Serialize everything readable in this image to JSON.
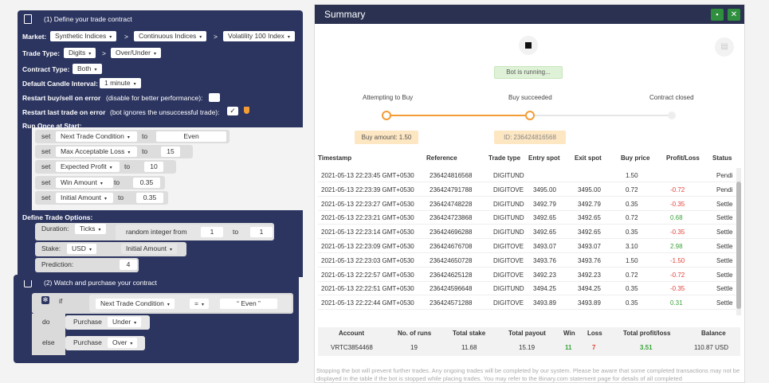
{
  "blocks": {
    "define_title": "(1) Define your trade contract",
    "market_label": "Market:",
    "market": "Synthetic Indices",
    "submarket": "Continuous Indices",
    "symbol": "Volatility 100 Index",
    "trade_type_label": "Trade Type:",
    "trade_type": "Digits",
    "trade_subtype": "Over/Under",
    "contract_type_label": "Contract Type:",
    "contract_type": "Both",
    "candle_label": "Default Candle Interval:",
    "candle": "1 minute",
    "restart_label": "Restart buy/sell on error",
    "restart_note": "(disable for better performance):",
    "restart_last_label": "Restart last trade on error",
    "restart_last_note": "(bot ignores the unsuccessful trade):",
    "run_once_label": "Run Once at Start:",
    "set": "set",
    "to": "to",
    "sets": [
      {
        "var": "Next Trade Condition",
        "value": "Even"
      },
      {
        "var": "Max Acceptable Loss",
        "value": "15"
      },
      {
        "var": "Expected Profit",
        "value": "10"
      },
      {
        "var": "Win Amount",
        "value": "0.35"
      },
      {
        "var": "Initial Amount",
        "value": "0.35"
      }
    ],
    "define_options_label": "Define Trade Options:",
    "duration_label": "Duration:",
    "duration_unit": "Ticks",
    "random_label": "random integer from",
    "random_from": "1",
    "random_to_label": "to",
    "random_to": "1",
    "stake_label": "Stake:",
    "currency": "USD",
    "stake_var": "Initial Amount",
    "prediction_label": "Prediction:",
    "prediction": "4",
    "watch_title": "(2) Watch and purchase your contract",
    "if_label": "if",
    "cond_var": "Next Trade Condition",
    "cond_op": "=",
    "cond_value": "Even",
    "do_label": "do",
    "else_label": "else",
    "purchase_label": "Purchase",
    "do_purchase": "Under",
    "else_purchase": "Over"
  },
  "summary": {
    "title": "Summary",
    "bot_status": "Bot is running...",
    "steps": [
      "Attempting to Buy",
      "Buy succeeded",
      "Contract closed"
    ],
    "buy_amount": "Buy amount: 1.50",
    "contract_id": "ID: 236424816568",
    "columns": [
      "Timestamp",
      "Reference",
      "Trade type",
      "Entry spot",
      "Exit spot",
      "Buy price",
      "Profit/Loss",
      "Status"
    ],
    "rows": [
      {
        "ts": "2021-05-13 22:23:45 GMT+0530",
        "ref": "236424816568",
        "type": "DIGITUND",
        "entry": "",
        "exit": "",
        "buy": "1.50",
        "pl": "",
        "plc": "",
        "status": "Pendi"
      },
      {
        "ts": "2021-05-13 22:23:39 GMT+0530",
        "ref": "236424791788",
        "type": "DIGITOVE",
        "entry": "3495.00",
        "exit": "3495.00",
        "buy": "0.72",
        "pl": "-0.72",
        "plc": "neg",
        "status": "Pendi"
      },
      {
        "ts": "2021-05-13 22:23:27 GMT+0530",
        "ref": "236424748228",
        "type": "DIGITUND",
        "entry": "3492.79",
        "exit": "3492.79",
        "buy": "0.35",
        "pl": "-0.35",
        "plc": "neg",
        "status": "Settle"
      },
      {
        "ts": "2021-05-13 22:23:21 GMT+0530",
        "ref": "236424723868",
        "type": "DIGITUND",
        "entry": "3492.65",
        "exit": "3492.65",
        "buy": "0.72",
        "pl": "0.68",
        "plc": "pos",
        "status": "Settle"
      },
      {
        "ts": "2021-05-13 22:23:14 GMT+0530",
        "ref": "236424696288",
        "type": "DIGITUND",
        "entry": "3492.65",
        "exit": "3492.65",
        "buy": "0.35",
        "pl": "-0.35",
        "plc": "neg",
        "status": "Settle"
      },
      {
        "ts": "2021-05-13 22:23:09 GMT+0530",
        "ref": "236424676708",
        "type": "DIGITOVE",
        "entry": "3493.07",
        "exit": "3493.07",
        "buy": "3.10",
        "pl": "2.98",
        "plc": "pos",
        "status": "Settle"
      },
      {
        "ts": "2021-05-13 22:23:03 GMT+0530",
        "ref": "236424650728",
        "type": "DIGITOVE",
        "entry": "3493.76",
        "exit": "3493.76",
        "buy": "1.50",
        "pl": "-1.50",
        "plc": "neg",
        "status": "Settle"
      },
      {
        "ts": "2021-05-13 22:22:57 GMT+0530",
        "ref": "236424625128",
        "type": "DIGITOVE",
        "entry": "3492.23",
        "exit": "3492.23",
        "buy": "0.72",
        "pl": "-0.72",
        "plc": "neg",
        "status": "Settle"
      },
      {
        "ts": "2021-05-13 22:22:51 GMT+0530",
        "ref": "236424596648",
        "type": "DIGITUND",
        "entry": "3494.25",
        "exit": "3494.25",
        "buy": "0.35",
        "pl": "-0.35",
        "plc": "neg",
        "status": "Settle"
      },
      {
        "ts": "2021-05-13 22:22:44 GMT+0530",
        "ref": "236424571288",
        "type": "DIGITOVE",
        "entry": "3493.89",
        "exit": "3493.89",
        "buy": "0.35",
        "pl": "0.31",
        "plc": "pos",
        "status": "Settle"
      }
    ],
    "totals_headers": [
      "Account",
      "No. of runs",
      "Total stake",
      "Total payout",
      "Win",
      "Loss",
      "Total profit/loss",
      "Balance"
    ],
    "totals": {
      "account": "VRTC3854468",
      "runs": "19",
      "stake": "11.68",
      "payout": "15.19",
      "win": "11",
      "loss": "7",
      "pl": "3.51",
      "balance": "110.87 USD"
    },
    "footnote": "Stopping the bot will prevent further trades. Any ongoing trades will be completed by our system. Please be aware that some completed transactions may not be displayed in the table if the bot is stopped while placing trades. You may refer to the Binary.com statement page for details of all completed"
  },
  "colors": {
    "block": "#2c3560",
    "accent": "#f39c35",
    "loss": "#e0443c",
    "profit": "#3aa33a",
    "header": "#2b3251"
  }
}
